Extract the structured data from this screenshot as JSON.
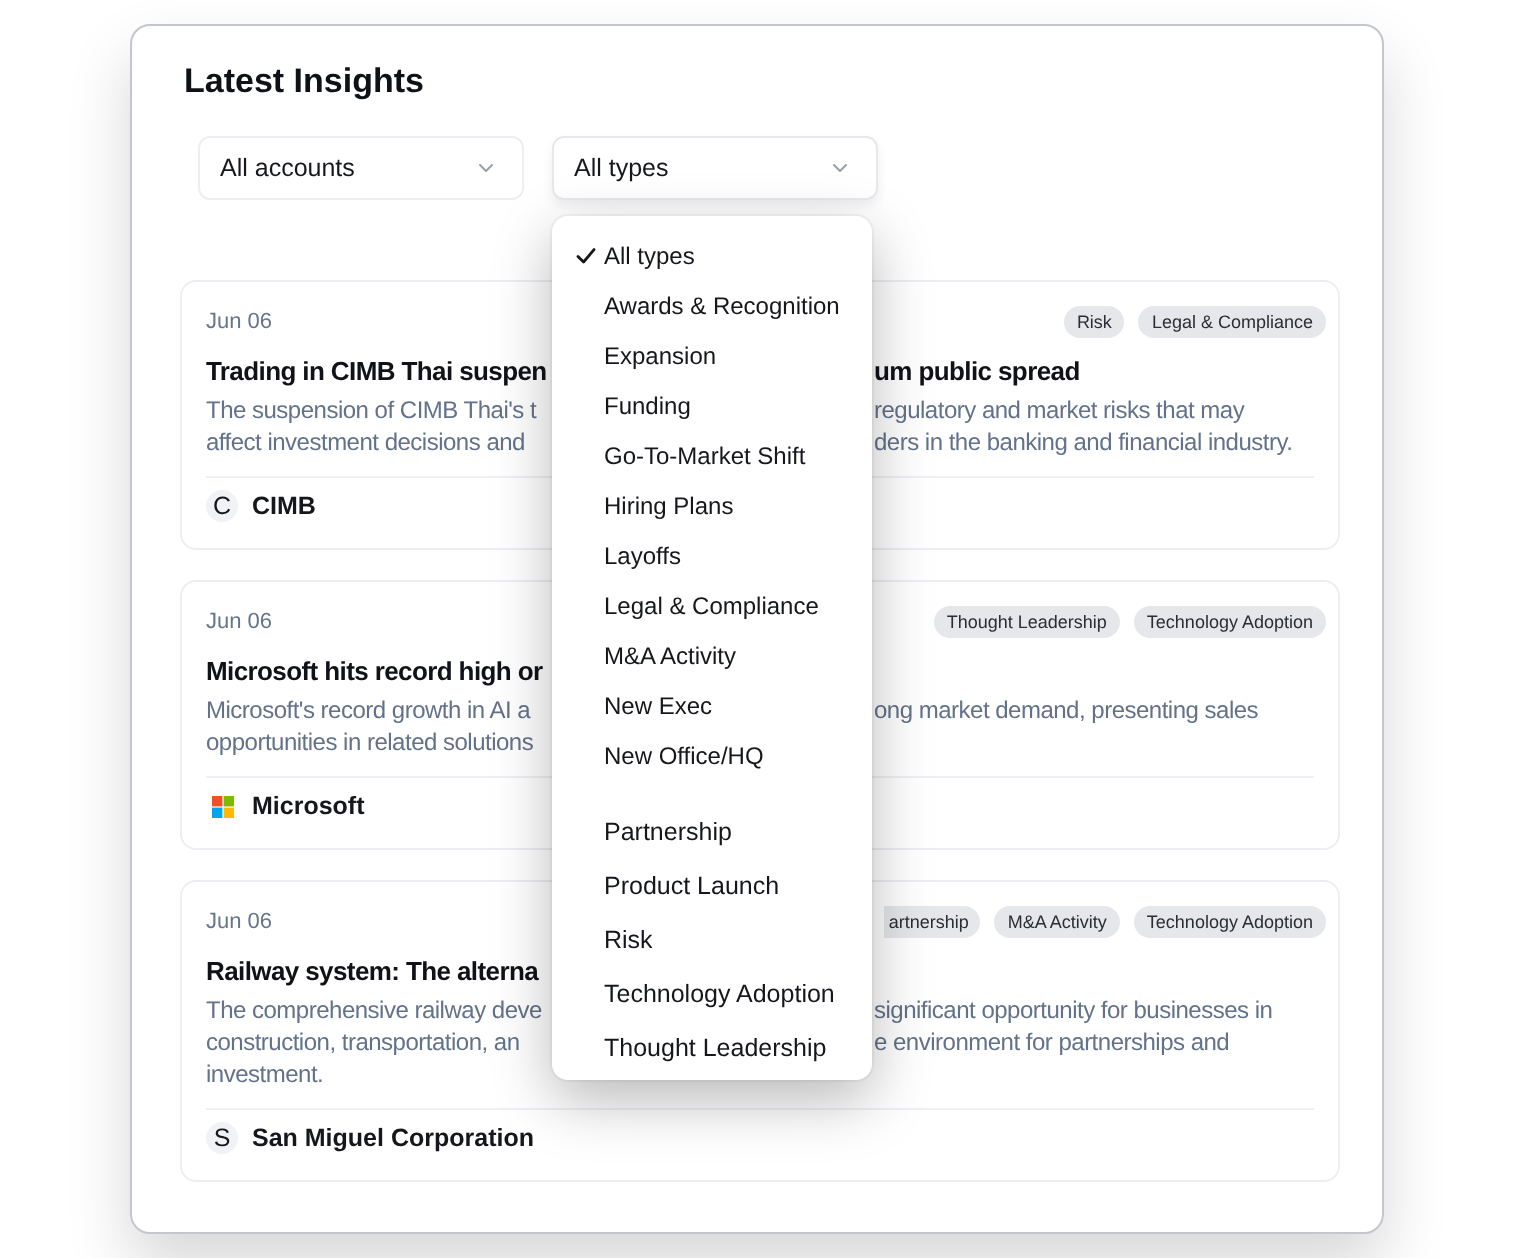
{
  "panel": {
    "title": "Latest Insights"
  },
  "filters": [
    {
      "value": "All accounts",
      "open": false
    },
    {
      "value": "All types",
      "open": true,
      "menu": {
        "option_groups": [
          {
            "options": [
              {
                "label": "All types",
                "selected": true
              },
              {
                "label": "Awards & Recognition",
                "selected": false
              },
              {
                "label": "Expansion",
                "selected": false
              },
              {
                "label": "Funding",
                "selected": false
              },
              {
                "label": "Go-To-Market Shift",
                "selected": false
              },
              {
                "label": "Hiring Plans",
                "selected": false
              },
              {
                "label": "Layoffs",
                "selected": false
              },
              {
                "label": "Legal & Compliance",
                "selected": false
              },
              {
                "label": "M&A Activity",
                "selected": false
              },
              {
                "label": "New Exec",
                "selected": false
              },
              {
                "label": "New Office/HQ",
                "selected": false
              }
            ]
          },
          {
            "options": [
              {
                "label": "Partnership",
                "selected": false
              },
              {
                "label": "Product Launch",
                "selected": false
              },
              {
                "label": "Risk",
                "selected": false
              },
              {
                "label": "Technology Adoption",
                "selected": false
              },
              {
                "label": "Thought Leadership",
                "selected": false
              }
            ]
          }
        ]
      }
    }
  ],
  "insights": [
    {
      "date": "Jun 06",
      "tags": [
        {
          "label": "Risk",
          "clipped": false
        },
        {
          "label": "Legal & Compliance",
          "clipped": false
        }
      ],
      "title": {
        "left": "Trading in CIMB Thai suspen",
        "right": "um public spread"
      },
      "summary_lines": [
        {
          "left": "The suspension of CIMB Thai's t",
          "right": "regulatory and market risks that may"
        },
        {
          "left": "affect investment decisions and",
          "right": "ders in the banking and financial industry."
        }
      ],
      "company": {
        "logo": {
          "kind": "letter",
          "letter": "C"
        },
        "name": "CIMB"
      }
    },
    {
      "date": "Jun 06",
      "tags": [
        {
          "label": "Thought Leadership",
          "clipped": false
        },
        {
          "label": "Technology Adoption",
          "clipped": false
        }
      ],
      "title": {
        "left": "Microsoft hits record high or"
      },
      "summary_lines": [
        {
          "left": "Microsoft's record growth in AI a",
          "right": "ong market demand, presenting sales"
        },
        {
          "left": "opportunities in related solutions"
        }
      ],
      "company": {
        "logo": {
          "kind": "four-squares"
        },
        "name": "Microsoft"
      }
    },
    {
      "date": "Jun 06",
      "tags": [
        {
          "label": "artnership",
          "clipped": true
        },
        {
          "label": "M&A Activity",
          "clipped": false
        },
        {
          "label": "Technology Adoption",
          "clipped": false
        }
      ],
      "title": {
        "left": "Railway system: The alterna"
      },
      "summary_lines": [
        {
          "left": "The comprehensive railway deve",
          "right": "significant opportunity for businesses in"
        },
        {
          "left": "construction, transportation, an",
          "right": "e environment for partnerships and"
        },
        {
          "left": "investment."
        }
      ],
      "company": {
        "logo": {
          "kind": "letter",
          "letter": "S"
        },
        "name": "San Miguel Corporation"
      }
    }
  ]
}
